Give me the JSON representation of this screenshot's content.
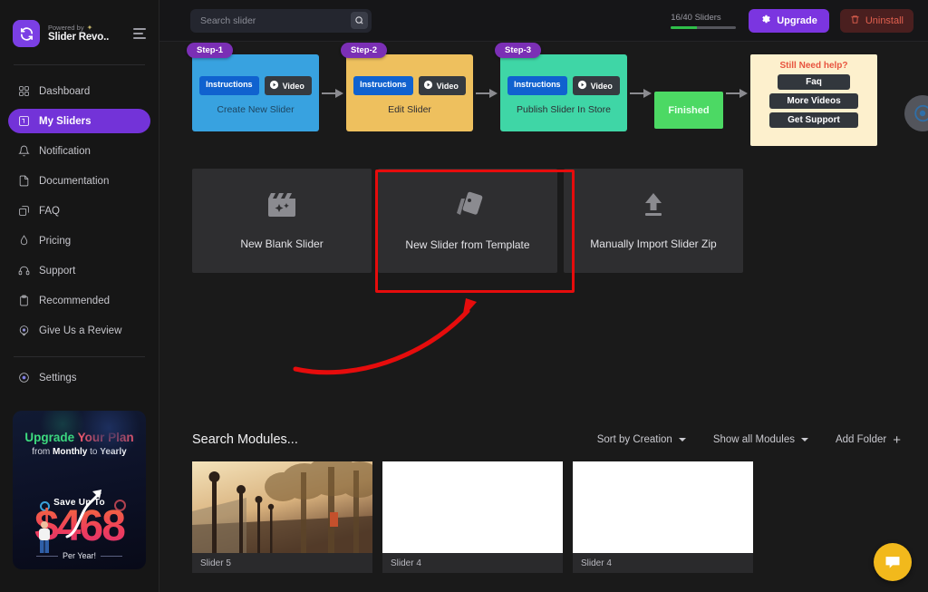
{
  "sidebar": {
    "powered_by": "Powered by",
    "brand_name": "Slider Revo..",
    "menu_icon": "hamburger-icon",
    "items": [
      {
        "label": "Dashboard",
        "icon": "grid-icon",
        "active": false
      },
      {
        "label": "My Sliders",
        "icon": "sliders-icon",
        "active": true
      },
      {
        "label": "Notification",
        "icon": "bell-icon",
        "active": false
      },
      {
        "label": "Documentation",
        "icon": "document-icon",
        "active": false
      },
      {
        "label": "FAQ",
        "icon": "faq-icon",
        "active": false
      },
      {
        "label": "Pricing",
        "icon": "pricing-icon",
        "active": false
      },
      {
        "label": "Support",
        "icon": "headset-icon",
        "active": false
      },
      {
        "label": "Recommended",
        "icon": "clipboard-icon",
        "active": false
      },
      {
        "label": "Give Us a Review",
        "icon": "review-icon",
        "active": false
      }
    ],
    "settings": {
      "label": "Settings",
      "icon": "gear-icon"
    },
    "promo": {
      "title_green": "Upgrade ",
      "title_red": "Your Plan",
      "subtitle_pre": "from ",
      "subtitle_b1": "Monthly",
      "subtitle_mid": " to ",
      "subtitle_b2": "Yearly",
      "save_label": "Save Up To",
      "amount": "$468",
      "period": "Per Year!"
    }
  },
  "topbar": {
    "search": {
      "placeholder": "Search slider",
      "value": "",
      "icon": "search-icon"
    },
    "quota_label": "16/40 Sliders",
    "quota_percent": 40,
    "upgrade_label": "Upgrade",
    "upgrade_icon": "gear-icon",
    "uninstall_label": "Uninstall",
    "uninstall_icon": "trash-icon"
  },
  "steps": [
    {
      "badge": "Step-1",
      "instructions_label": "Instructions",
      "video_label": "Video",
      "caption": "Create New Slider",
      "color": "#38a2e0"
    },
    {
      "badge": "Step-2",
      "instructions_label": "Instructions",
      "video_label": "Video",
      "caption": "Edit Slider",
      "color": "#eec05e"
    },
    {
      "badge": "Step-3",
      "instructions_label": "Instructions",
      "video_label": "Video",
      "caption": "Publish Slider In Store",
      "color": "#3fd6a6"
    }
  ],
  "finished_label": "Finished",
  "help": {
    "title": "Still Need help?",
    "buttons": [
      "Faq",
      "More Videos",
      "Get Support"
    ]
  },
  "create_cards": [
    {
      "label": "New Blank Slider",
      "icon": "clapperboard-sparkle-icon",
      "highlighted": false
    },
    {
      "label": "New Slider from Template",
      "icon": "template-cards-icon",
      "highlighted": true
    },
    {
      "label": "Manually Import Slider Zip",
      "icon": "upload-icon",
      "highlighted": false
    }
  ],
  "modules": {
    "title": "Search Modules...",
    "sort_label": "Sort by Creation",
    "filter_label": "Show all Modules",
    "add_folder_label": "Add Folder",
    "items": [
      {
        "name": "Slider 5",
        "has_image": true
      },
      {
        "name": "Slider 4",
        "has_image": false
      },
      {
        "name": "Slider 4",
        "has_image": false
      }
    ]
  },
  "chat_fab_icon": "chat-bubble-icon",
  "edge_widget_icon": "circle-c-icon",
  "annotation": {
    "highlight_target": "New Slider from Template",
    "highlight_color": "#e60c0c",
    "arrow_color": "#e60c0c"
  }
}
